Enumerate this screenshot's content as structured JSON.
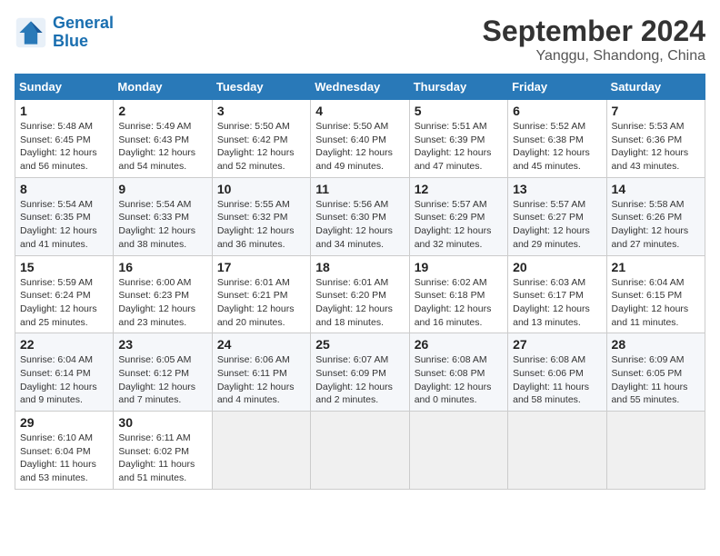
{
  "header": {
    "logo_line1": "General",
    "logo_line2": "Blue",
    "month": "September 2024",
    "location": "Yanggu, Shandong, China"
  },
  "columns": [
    "Sunday",
    "Monday",
    "Tuesday",
    "Wednesday",
    "Thursday",
    "Friday",
    "Saturday"
  ],
  "weeks": [
    [
      {
        "day": "1",
        "info": "Sunrise: 5:48 AM\nSunset: 6:45 PM\nDaylight: 12 hours\nand 56 minutes."
      },
      {
        "day": "2",
        "info": "Sunrise: 5:49 AM\nSunset: 6:43 PM\nDaylight: 12 hours\nand 54 minutes."
      },
      {
        "day": "3",
        "info": "Sunrise: 5:50 AM\nSunset: 6:42 PM\nDaylight: 12 hours\nand 52 minutes."
      },
      {
        "day": "4",
        "info": "Sunrise: 5:50 AM\nSunset: 6:40 PM\nDaylight: 12 hours\nand 49 minutes."
      },
      {
        "day": "5",
        "info": "Sunrise: 5:51 AM\nSunset: 6:39 PM\nDaylight: 12 hours\nand 47 minutes."
      },
      {
        "day": "6",
        "info": "Sunrise: 5:52 AM\nSunset: 6:38 PM\nDaylight: 12 hours\nand 45 minutes."
      },
      {
        "day": "7",
        "info": "Sunrise: 5:53 AM\nSunset: 6:36 PM\nDaylight: 12 hours\nand 43 minutes."
      }
    ],
    [
      {
        "day": "8",
        "info": "Sunrise: 5:54 AM\nSunset: 6:35 PM\nDaylight: 12 hours\nand 41 minutes."
      },
      {
        "day": "9",
        "info": "Sunrise: 5:54 AM\nSunset: 6:33 PM\nDaylight: 12 hours\nand 38 minutes."
      },
      {
        "day": "10",
        "info": "Sunrise: 5:55 AM\nSunset: 6:32 PM\nDaylight: 12 hours\nand 36 minutes."
      },
      {
        "day": "11",
        "info": "Sunrise: 5:56 AM\nSunset: 6:30 PM\nDaylight: 12 hours\nand 34 minutes."
      },
      {
        "day": "12",
        "info": "Sunrise: 5:57 AM\nSunset: 6:29 PM\nDaylight: 12 hours\nand 32 minutes."
      },
      {
        "day": "13",
        "info": "Sunrise: 5:57 AM\nSunset: 6:27 PM\nDaylight: 12 hours\nand 29 minutes."
      },
      {
        "day": "14",
        "info": "Sunrise: 5:58 AM\nSunset: 6:26 PM\nDaylight: 12 hours\nand 27 minutes."
      }
    ],
    [
      {
        "day": "15",
        "info": "Sunrise: 5:59 AM\nSunset: 6:24 PM\nDaylight: 12 hours\nand 25 minutes."
      },
      {
        "day": "16",
        "info": "Sunrise: 6:00 AM\nSunset: 6:23 PM\nDaylight: 12 hours\nand 23 minutes."
      },
      {
        "day": "17",
        "info": "Sunrise: 6:01 AM\nSunset: 6:21 PM\nDaylight: 12 hours\nand 20 minutes."
      },
      {
        "day": "18",
        "info": "Sunrise: 6:01 AM\nSunset: 6:20 PM\nDaylight: 12 hours\nand 18 minutes."
      },
      {
        "day": "19",
        "info": "Sunrise: 6:02 AM\nSunset: 6:18 PM\nDaylight: 12 hours\nand 16 minutes."
      },
      {
        "day": "20",
        "info": "Sunrise: 6:03 AM\nSunset: 6:17 PM\nDaylight: 12 hours\nand 13 minutes."
      },
      {
        "day": "21",
        "info": "Sunrise: 6:04 AM\nSunset: 6:15 PM\nDaylight: 12 hours\nand 11 minutes."
      }
    ],
    [
      {
        "day": "22",
        "info": "Sunrise: 6:04 AM\nSunset: 6:14 PM\nDaylight: 12 hours\nand 9 minutes."
      },
      {
        "day": "23",
        "info": "Sunrise: 6:05 AM\nSunset: 6:12 PM\nDaylight: 12 hours\nand 7 minutes."
      },
      {
        "day": "24",
        "info": "Sunrise: 6:06 AM\nSunset: 6:11 PM\nDaylight: 12 hours\nand 4 minutes."
      },
      {
        "day": "25",
        "info": "Sunrise: 6:07 AM\nSunset: 6:09 PM\nDaylight: 12 hours\nand 2 minutes."
      },
      {
        "day": "26",
        "info": "Sunrise: 6:08 AM\nSunset: 6:08 PM\nDaylight: 12 hours\nand 0 minutes."
      },
      {
        "day": "27",
        "info": "Sunrise: 6:08 AM\nSunset: 6:06 PM\nDaylight: 11 hours\nand 58 minutes."
      },
      {
        "day": "28",
        "info": "Sunrise: 6:09 AM\nSunset: 6:05 PM\nDaylight: 11 hours\nand 55 minutes."
      }
    ],
    [
      {
        "day": "29",
        "info": "Sunrise: 6:10 AM\nSunset: 6:04 PM\nDaylight: 11 hours\nand 53 minutes."
      },
      {
        "day": "30",
        "info": "Sunrise: 6:11 AM\nSunset: 6:02 PM\nDaylight: 11 hours\nand 51 minutes."
      },
      {
        "day": "",
        "info": ""
      },
      {
        "day": "",
        "info": ""
      },
      {
        "day": "",
        "info": ""
      },
      {
        "day": "",
        "info": ""
      },
      {
        "day": "",
        "info": ""
      }
    ]
  ]
}
